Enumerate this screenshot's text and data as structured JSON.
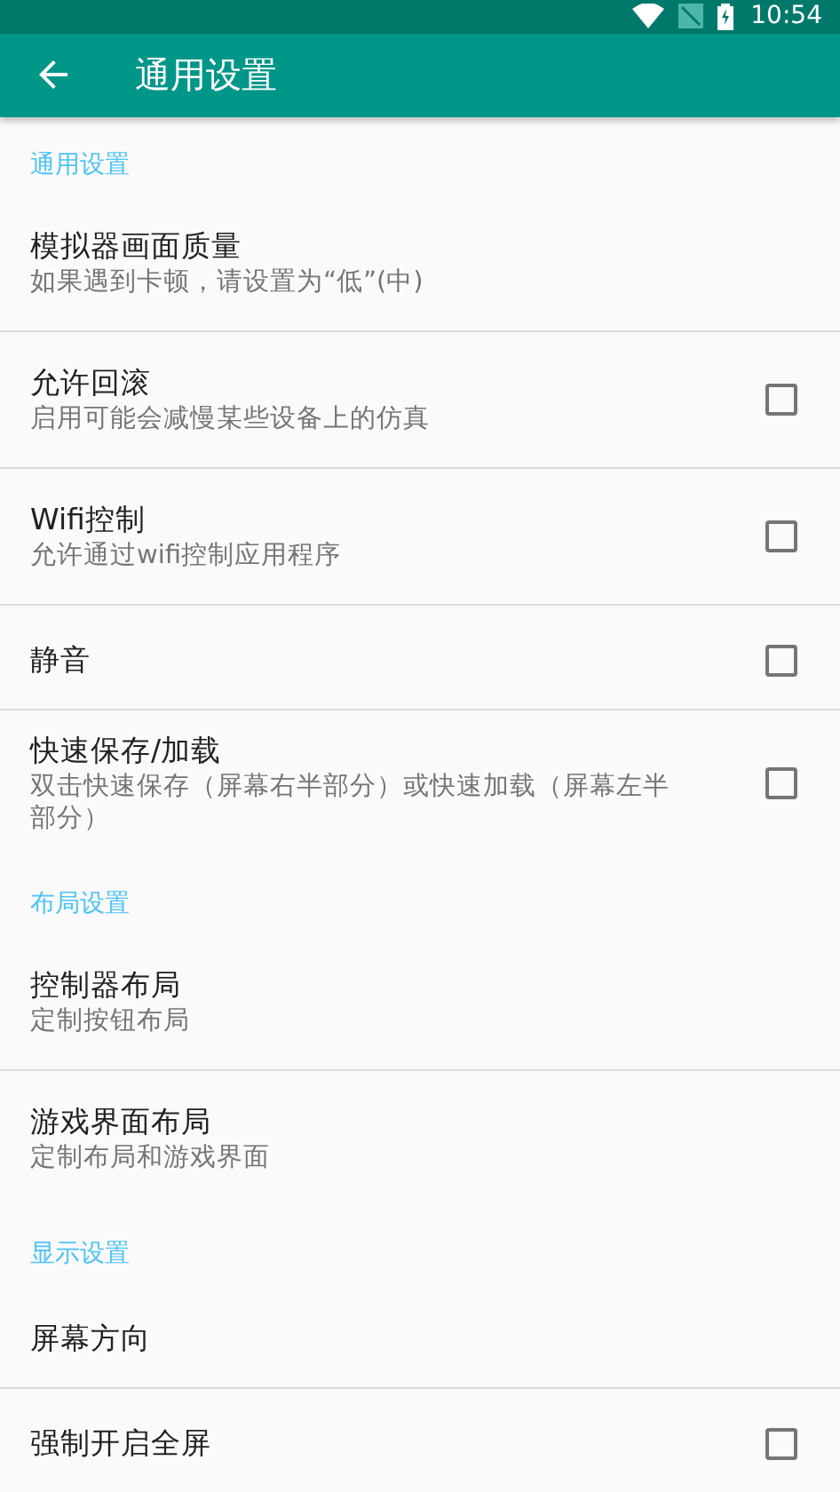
{
  "status_bar": {
    "time": "10:54"
  },
  "app_bar": {
    "title": "通用设置"
  },
  "sections": [
    {
      "header": "通用设置",
      "items": [
        {
          "kind": "plain",
          "title": "模拟器画面质量",
          "summary": "如果遇到卡顿，请设置为“低”(中)"
        },
        {
          "kind": "checkbox",
          "title": "允许回滚",
          "summary": "启用可能会减慢某些设备上的仿真",
          "checked": false
        },
        {
          "kind": "checkbox",
          "title": "Wifi控制",
          "summary": "允许通过wifi控制应用程序",
          "checked": false
        },
        {
          "kind": "checkbox",
          "title": "静音",
          "checked": false
        },
        {
          "kind": "checkbox",
          "title": "快速保存/加载",
          "summary": "双击快速保存（屏幕右半部分）或快速加载（屏幕左半部分）",
          "checked": false
        }
      ]
    },
    {
      "header": "布局设置",
      "items": [
        {
          "kind": "plain",
          "title": "控制器布局",
          "summary": "定制按钮布局"
        },
        {
          "kind": "plain",
          "title": "游戏界面布局",
          "summary": "定制布局和游戏界面"
        }
      ]
    },
    {
      "header": "显示设置",
      "items": [
        {
          "kind": "plain",
          "title": "屏幕方向"
        },
        {
          "kind": "checkbox",
          "title": "强制开启全屏",
          "checked": false
        }
      ]
    }
  ]
}
